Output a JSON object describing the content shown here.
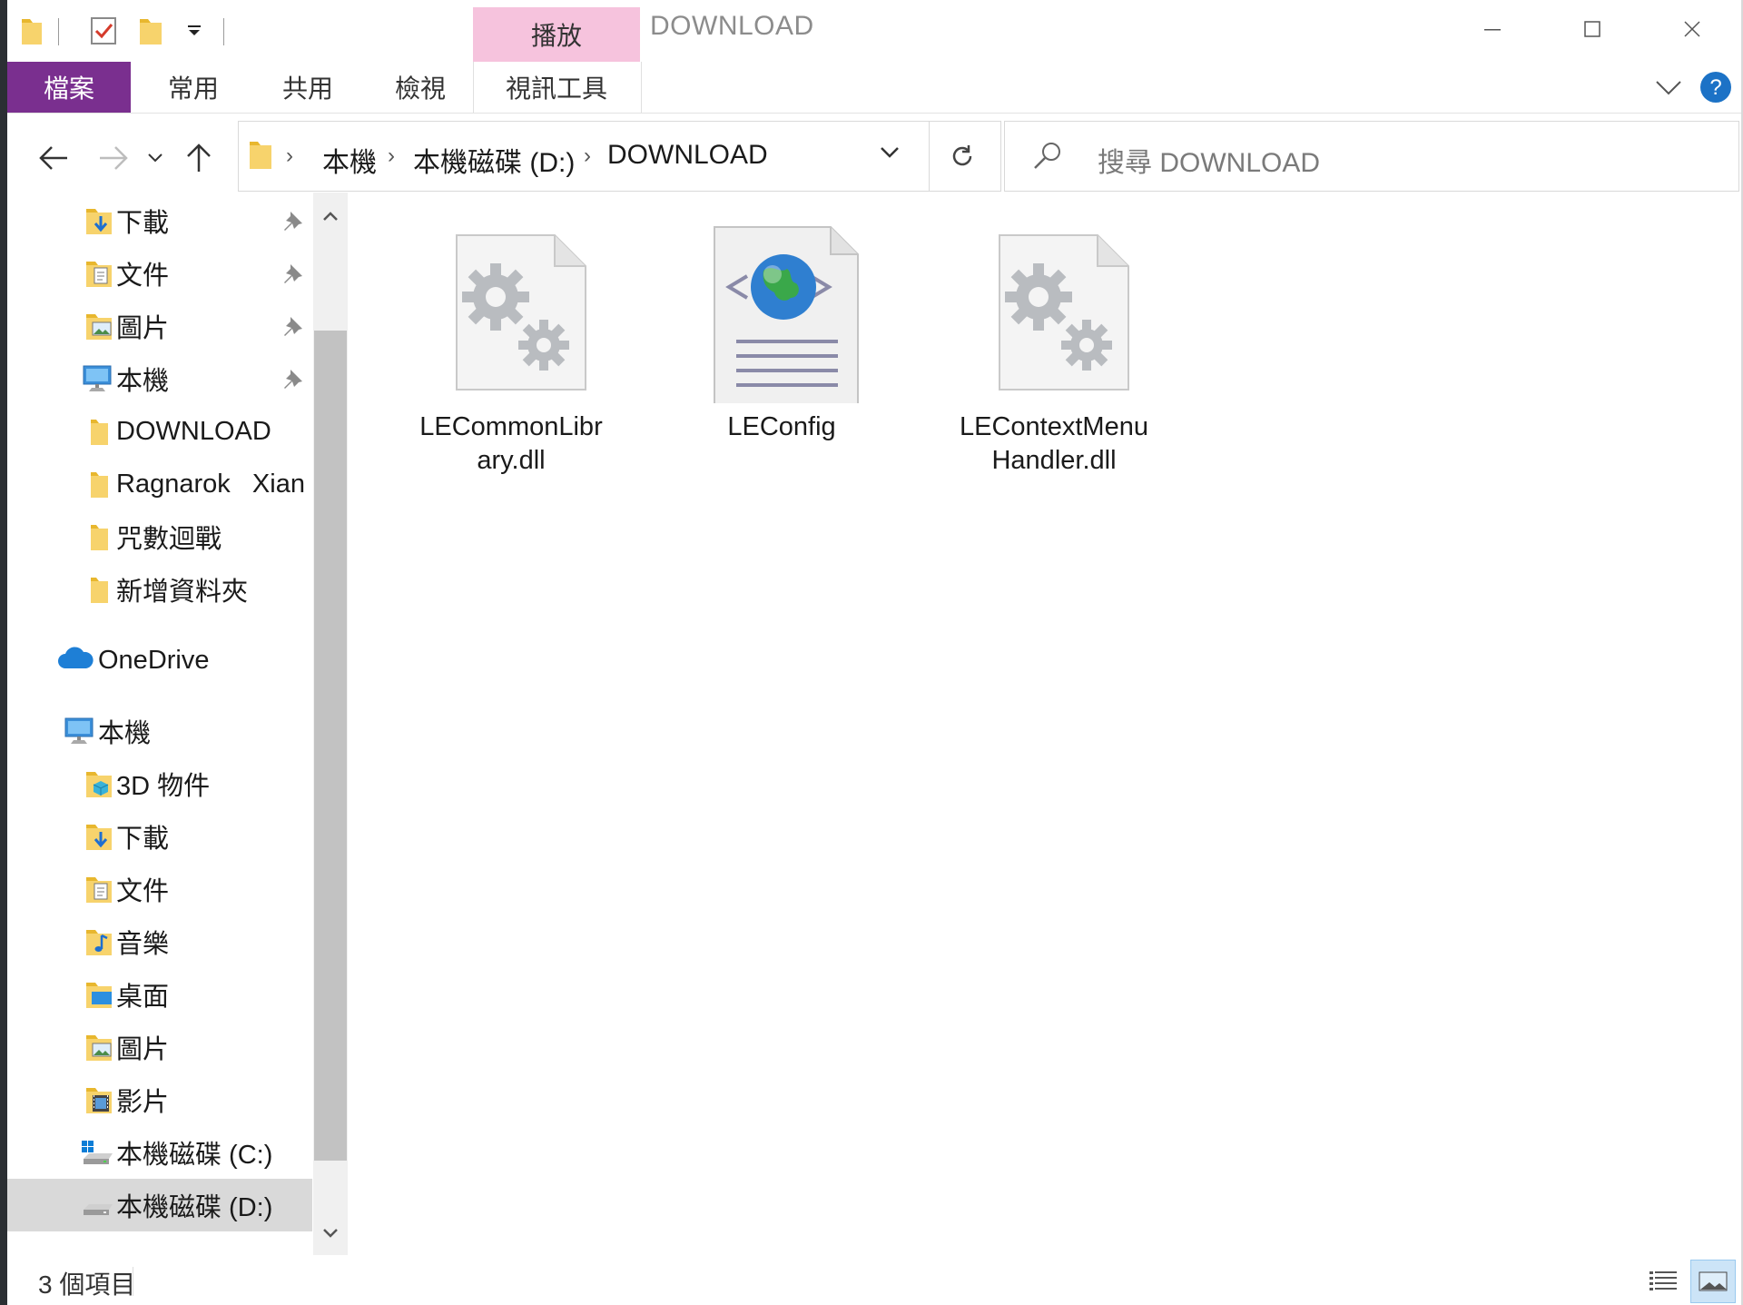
{
  "window": {
    "title": "DOWNLOAD",
    "context_tab_header": "播放"
  },
  "ribbon": {
    "tabs": [
      "檔案",
      "常用",
      "共用",
      "檢視",
      "視訊工具"
    ]
  },
  "address": {
    "breadcrumb": [
      "本機",
      "本機磁碟 (D:)",
      "DOWNLOAD"
    ]
  },
  "search": {
    "placeholder": "搜尋 DOWNLOAD"
  },
  "nav": {
    "quick_access": [
      {
        "label": "下載",
        "icon": "downloads-folder-icon",
        "pinned": true
      },
      {
        "label": "文件",
        "icon": "documents-folder-icon",
        "pinned": true
      },
      {
        "label": "圖片",
        "icon": "pictures-folder-icon",
        "pinned": true
      },
      {
        "label": "本機",
        "icon": "computer-icon",
        "pinned": true
      },
      {
        "label": "DOWNLOAD",
        "icon": "folder-icon",
        "pinned": false
      },
      {
        "label": "Ragnarok   Xian",
        "icon": "folder-icon",
        "pinned": false
      },
      {
        "label": "咒數迴戰",
        "icon": "folder-icon",
        "pinned": false
      },
      {
        "label": "新增資料夾",
        "icon": "folder-icon",
        "pinned": false
      }
    ],
    "onedrive": "OneDrive",
    "this_pc": "本機",
    "this_pc_items": [
      {
        "label": "3D 物件",
        "icon": "3d-objects-folder-icon"
      },
      {
        "label": "下載",
        "icon": "downloads-folder-icon"
      },
      {
        "label": "文件",
        "icon": "documents-folder-icon"
      },
      {
        "label": "音樂",
        "icon": "music-folder-icon"
      },
      {
        "label": "桌面",
        "icon": "desktop-folder-icon"
      },
      {
        "label": "圖片",
        "icon": "pictures-folder-icon"
      },
      {
        "label": "影片",
        "icon": "videos-folder-icon"
      },
      {
        "label": "本機磁碟 (C:)",
        "icon": "windows-drive-icon"
      },
      {
        "label": "本機磁碟 (D:)",
        "icon": "drive-icon",
        "selected": true
      }
    ]
  },
  "files": [
    {
      "name": "LECommonLibrary.dll",
      "display": [
        "LECommonLibr",
        "ary.dll"
      ],
      "icon": "dll-gear-file-icon"
    },
    {
      "name": "LEConfig",
      "display": [
        "LEConfig"
      ],
      "icon": "xml-config-file-icon"
    },
    {
      "name": "LEContextMenuHandler.dll",
      "display": [
        "LEContextMenu",
        "Handler.dll"
      ],
      "icon": "dll-gear-file-icon"
    }
  ],
  "status": {
    "item_count": "3 個項目"
  },
  "colors": {
    "file_tab": "#7a2f8f",
    "context_tab": "#f6c3dd",
    "selection": "#d9d9d9",
    "help": "#1c72c6"
  }
}
